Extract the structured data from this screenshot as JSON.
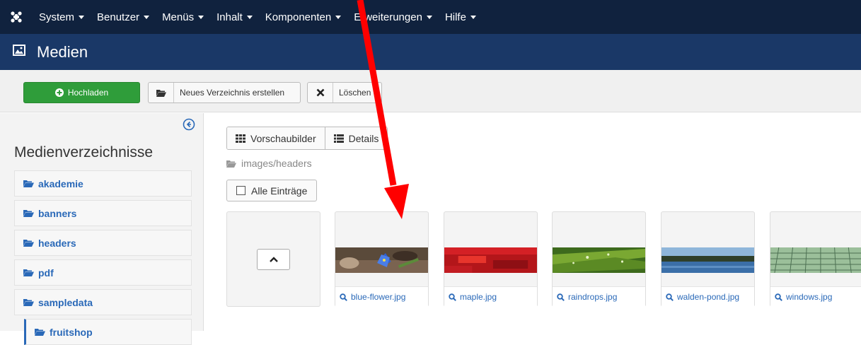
{
  "nav": {
    "items": [
      {
        "label": "System",
        "name": "menu-system"
      },
      {
        "label": "Benutzer",
        "name": "menu-benutzer"
      },
      {
        "label": "Menüs",
        "name": "menu-menues"
      },
      {
        "label": "Inhalt",
        "name": "menu-inhalt"
      },
      {
        "label": "Komponenten",
        "name": "menu-komponenten"
      },
      {
        "label": "Erweiterungen",
        "name": "menu-erweiterungen"
      },
      {
        "label": "Hilfe",
        "name": "menu-hilfe"
      }
    ]
  },
  "header": {
    "title": "Medien",
    "icon": "image-icon"
  },
  "toolbar": {
    "upload_label": "Hochladen",
    "new_folder_label": "Neues Verzeichnis erstellen",
    "delete_label": "Löschen"
  },
  "sidebar": {
    "title": "Medienverzeichnisse",
    "folders": [
      "akademie",
      "banners",
      "headers",
      "pdf",
      "sampledata",
      "fruitshop"
    ]
  },
  "main": {
    "view_thumbs_label": "Vorschaubilder",
    "view_details_label": "Details",
    "breadcrumb": "images/headers",
    "select_all_label": "Alle Einträge",
    "files": [
      "blue-flower.jpg",
      "maple.jpg",
      "raindrops.jpg",
      "walden-pond.jpg",
      "windows.jpg"
    ]
  },
  "colors": {
    "nav_bg": "#10223e",
    "header_bg": "#1a3867",
    "upload_green": "#2f9d3a",
    "link_blue": "#2a69b8",
    "annotation_red": "#ff0000"
  }
}
